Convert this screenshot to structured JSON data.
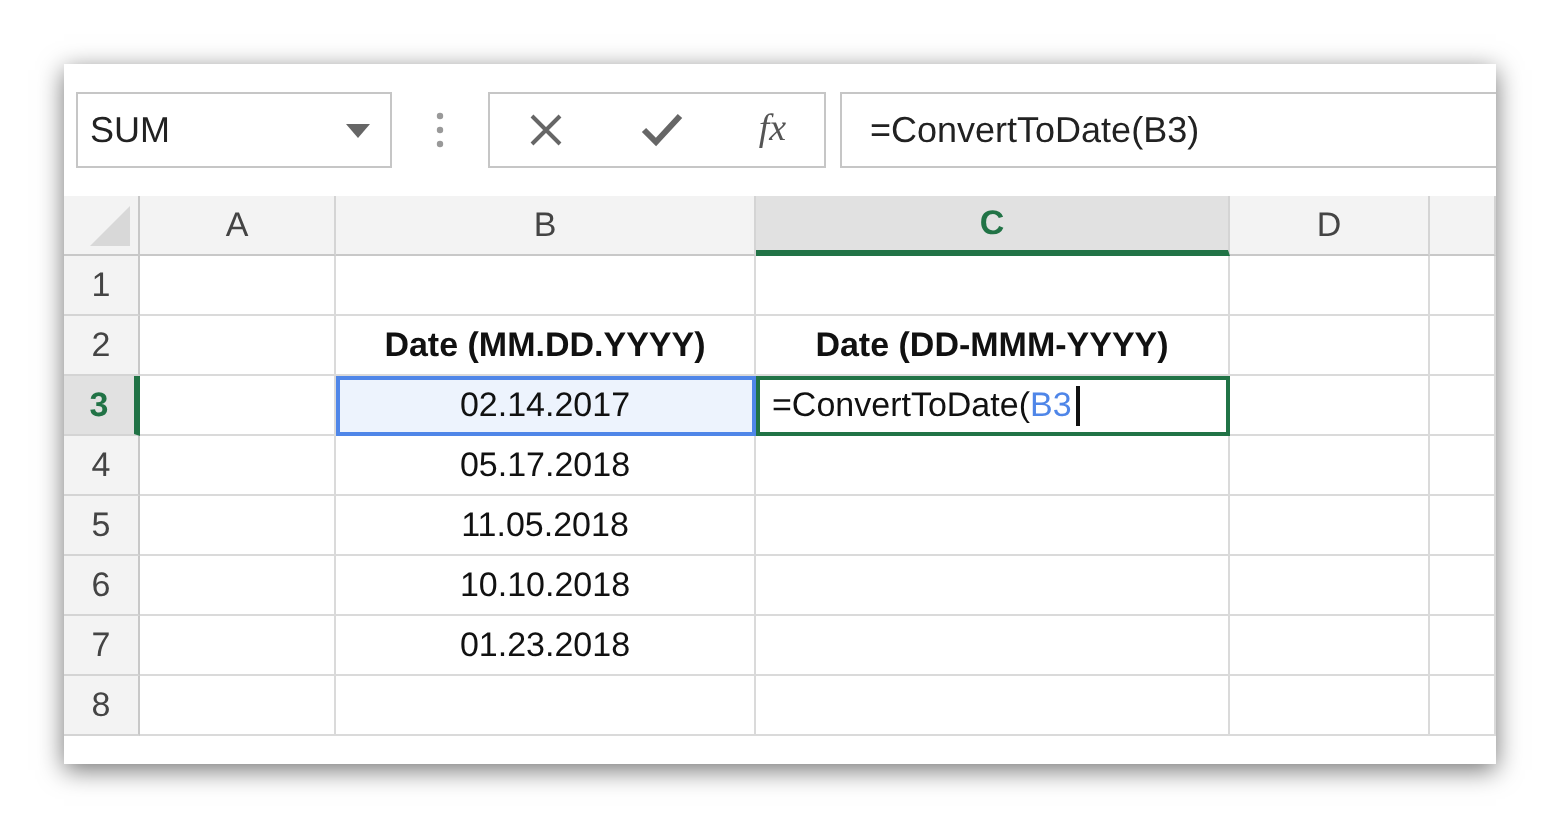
{
  "name_box": {
    "value": "SUM"
  },
  "formula_buttons": [
    {
      "kind": "cancel"
    },
    {
      "kind": "enter"
    },
    {
      "kind": "function",
      "label": "fx"
    }
  ],
  "formula_bar": {
    "value": "=ConvertToDate(B3)"
  },
  "columns": [
    {
      "label": "A",
      "selected": false
    },
    {
      "label": "B",
      "selected": false
    },
    {
      "label": "C",
      "selected": true
    },
    {
      "label": "D",
      "selected": false
    }
  ],
  "rows": [
    {
      "number": "1",
      "selected": false
    },
    {
      "number": "2",
      "selected": false,
      "B": {
        "text": "Date (MM.DD.YYYY)",
        "bold": true
      },
      "C": {
        "text": "Date (DD-MMM-YYYY)",
        "bold": true
      }
    },
    {
      "number": "3",
      "selected": true,
      "B": {
        "text": "02.14.2017",
        "bold": false,
        "referenced": true
      },
      "C": {
        "editing": true,
        "parts": [
          {
            "kind": "plain",
            "text": "=ConvertToDate("
          },
          {
            "kind": "ref",
            "text": "B3"
          }
        ]
      }
    },
    {
      "number": "4",
      "selected": false,
      "B": {
        "text": "05.17.2018",
        "bold": false
      }
    },
    {
      "number": "5",
      "selected": false,
      "B": {
        "text": "11.05.2018",
        "bold": false
      }
    },
    {
      "number": "6",
      "selected": false,
      "B": {
        "text": "10.10.2018",
        "bold": false
      }
    },
    {
      "number": "7",
      "selected": false,
      "B": {
        "text": "01.23.2018",
        "bold": false
      }
    },
    {
      "number": "8",
      "selected": false
    }
  ]
}
